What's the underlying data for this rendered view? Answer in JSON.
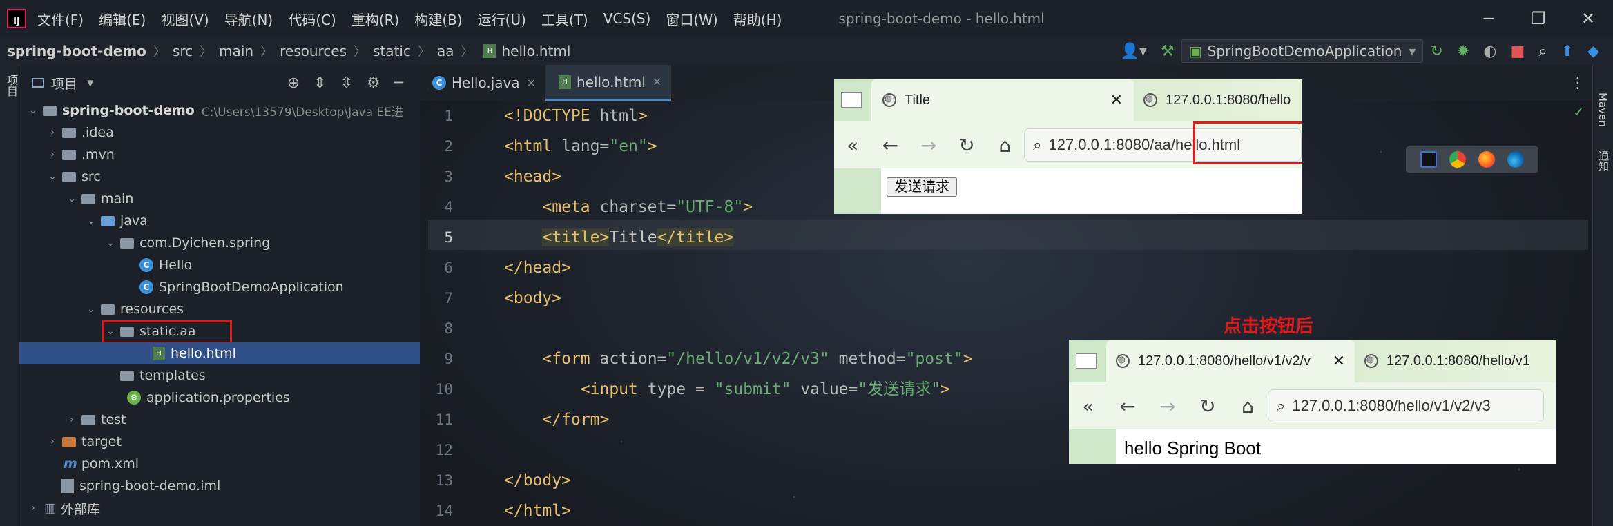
{
  "menubar": {
    "logo_text": "IJ",
    "items": [
      "文件(F)",
      "编辑(E)",
      "视图(V)",
      "导航(N)",
      "代码(C)",
      "重构(R)",
      "构建(B)",
      "运行(U)",
      "工具(T)",
      "VCS(S)",
      "窗口(W)",
      "帮助(H)"
    ],
    "window_title": "spring-boot-demo - hello.html"
  },
  "navbar": {
    "breadcrumbs": [
      "spring-boot-demo",
      "src",
      "main",
      "resources",
      "static",
      "aa",
      "hello.html"
    ],
    "run_config": "SpringBootDemoApplication"
  },
  "project_panel": {
    "title": "项目",
    "tree": [
      {
        "label": "spring-boot-demo",
        "path": "C:\\Users\\13579\\Desktop\\Java EE进",
        "bold": true
      },
      {
        "label": ".idea"
      },
      {
        "label": ".mvn"
      },
      {
        "label": "src"
      },
      {
        "label": "main"
      },
      {
        "label": "java"
      },
      {
        "label": "com.Dyichen.spring"
      },
      {
        "label": "Hello"
      },
      {
        "label": "SpringBootDemoApplication"
      },
      {
        "label": "resources"
      },
      {
        "label": "static.aa"
      },
      {
        "label": "hello.html"
      },
      {
        "label": "templates"
      },
      {
        "label": "application.properties"
      },
      {
        "label": "test"
      },
      {
        "label": "target"
      },
      {
        "label": "pom.xml"
      },
      {
        "label": "spring-boot-demo.iml"
      },
      {
        "label": "外部库"
      }
    ]
  },
  "left_strip": {
    "label": "项目"
  },
  "right_strip": {
    "maven": "Maven",
    "notify": "通知"
  },
  "editor": {
    "tabs": [
      {
        "label": "Hello.java"
      },
      {
        "label": "hello.html"
      }
    ],
    "line_numbers": [
      "1",
      "2",
      "3",
      "4",
      "5",
      "6",
      "7",
      "8",
      "9",
      "10",
      "11",
      "12",
      "13",
      "14"
    ],
    "current_line": 5
  },
  "browser1": {
    "tab_active": "Title",
    "tab_other": "127.0.0.1:8080/hello",
    "url_base": "127.0.0.1:8080",
    "url_path": "/aa/hello.html",
    "button_label": "发送请求"
  },
  "annotation": {
    "text": "点击按钮后"
  },
  "browser2": {
    "tab_active": "127.0.0.1:8080/hello/v1/v2/v",
    "tab_other": "127.0.0.1:8080/hello/v1",
    "url": "127.0.0.1:8080/hello/v1/v2/v3",
    "body_text": "hello Spring Boot"
  },
  "colors": {
    "accent": "#2f4f86",
    "annotation_red": "#e0191b",
    "tag_color": "#e8bf6a",
    "string_color": "#6aab73"
  }
}
